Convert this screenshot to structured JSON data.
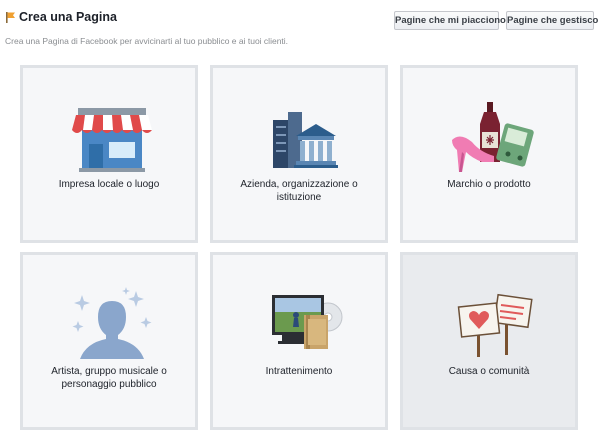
{
  "header": {
    "title": "Crea una Pagina",
    "subtitle": "Crea una Pagina di Facebook per avvicinarti al tuo pubblico e ai tuoi clienti.",
    "buttons": {
      "liked": "Pagine che mi piacciono",
      "managed": "Pagine che gestisco"
    }
  },
  "categories": [
    {
      "label": "Impresa locale o luogo",
      "icon": "storefront-icon"
    },
    {
      "label": "Azienda, organizzazione o istituzione",
      "icon": "buildings-icon"
    },
    {
      "label": "Marchio o prodotto",
      "icon": "products-icon"
    },
    {
      "label": "Artista, gruppo musicale o personaggio pubblico",
      "icon": "artist-silhouette-icon"
    },
    {
      "label": "Intrattenimento",
      "icon": "entertainment-icon"
    },
    {
      "label": "Causa o comunità",
      "icon": "protest-signs-icon"
    }
  ],
  "colors": {
    "tile_border": "#dfe2e6",
    "tile_bg": "#f6f7f9",
    "tile_active_bg": "#e9ebee"
  }
}
